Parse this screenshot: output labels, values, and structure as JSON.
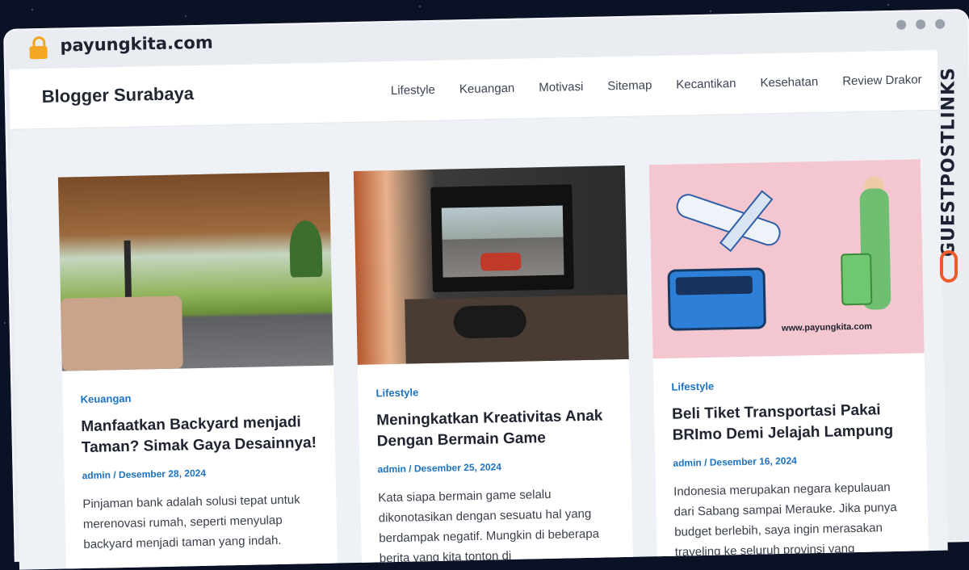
{
  "browser": {
    "url": "payungkita.com"
  },
  "site": {
    "brand": "Blogger Surabaya",
    "nav": [
      "Lifestyle",
      "Keuangan",
      "Motivasi",
      "Sitemap",
      "Kecantikan",
      "Kesehatan",
      "Review Drakor"
    ]
  },
  "posts": [
    {
      "category": "Keuangan",
      "title": "Manfaatkan Backyard menjadi Taman? Simak Gaya Desainnya!",
      "author": "admin",
      "date": "Desember 28, 2024",
      "excerpt": "Pinjaman bank adalah solusi tepat untuk merenovasi rumah, seperti menyulap backyard menjadi taman yang indah."
    },
    {
      "category": "Lifestyle",
      "title": "Meningkatkan Kreativitas Anak Dengan Bermain Game",
      "author": "admin",
      "date": "Desember 25, 2024",
      "excerpt": "Kata siapa bermain game selalu dikonotasikan dengan sesuatu hal yang berdampak negatif. Mungkin di beberapa berita yang kita tonton di"
    },
    {
      "category": "Lifestyle",
      "title": "Beli Tiket Transportasi Pakai BRImo Demi Jelajah Lampung",
      "author": "admin",
      "date": "Desember 16, 2024",
      "excerpt": "Indonesia merupakan negara kepulauan dari Sabang sampai Merauke. Jika punya budget berlebih, saya ingin merasakan traveling ke seluruh provinsi yang",
      "image_caption": "www.payungkita.com"
    }
  ],
  "watermark": {
    "text": "GUESTPOSTLINKS"
  }
}
